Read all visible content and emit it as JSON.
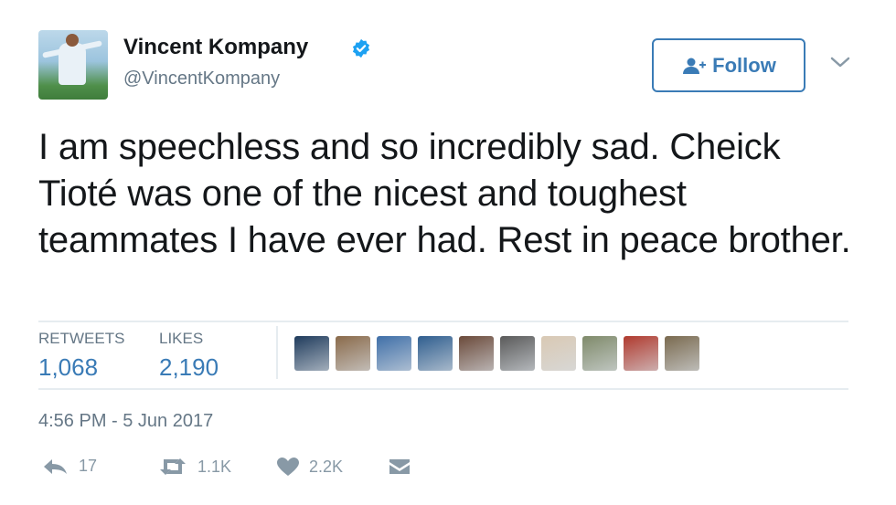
{
  "tweet": {
    "author": {
      "name": "Vincent Kompany",
      "handle": "@VincentKompany",
      "avatar_icon": "profile-photo-footballer",
      "verified_icon": "verified-badge-icon"
    },
    "follow_button": {
      "label": "Follow",
      "icon": "add-user-icon"
    },
    "menu_icon": "chevron-down-icon",
    "text": "I am speechless and so incredibly sad. Cheick Tioté was one of the nicest and toughest teammates I have ever had. Rest in peace brother.",
    "stats": {
      "retweets_label": "RETWEETS",
      "retweets_value": "1,068",
      "likes_label": "LIKES",
      "likes_value": "2,190"
    },
    "likers": [
      {
        "name": "liker-avatar-1",
        "color": "#1f3b5c"
      },
      {
        "name": "liker-avatar-2",
        "color": "#8a6a4a"
      },
      {
        "name": "liker-avatar-3",
        "color": "#3f6fa8"
      },
      {
        "name": "liker-avatar-4",
        "color": "#2f5e8f"
      },
      {
        "name": "liker-avatar-5",
        "color": "#6b4a3a"
      },
      {
        "name": "liker-avatar-6",
        "color": "#5a5a5a"
      },
      {
        "name": "liker-avatar-7",
        "color": "#d9c9b4"
      },
      {
        "name": "liker-avatar-8",
        "color": "#7f8a6a"
      },
      {
        "name": "liker-avatar-9",
        "color": "#b03a2e"
      },
      {
        "name": "liker-avatar-10",
        "color": "#7a6a4f"
      }
    ],
    "timestamp": "4:56 PM - 5 Jun 2017",
    "actions": {
      "reply": {
        "icon": "reply-icon",
        "count": "17"
      },
      "retweet": {
        "icon": "retweet-icon",
        "count": "1.1K"
      },
      "like": {
        "icon": "heart-icon",
        "count": "2.2K"
      },
      "message": {
        "icon": "direct-message-icon"
      }
    }
  },
  "colors": {
    "accent": "#3a7bb6",
    "muted": "#657786",
    "text": "#14171a",
    "divider": "#e6ecf0"
  }
}
